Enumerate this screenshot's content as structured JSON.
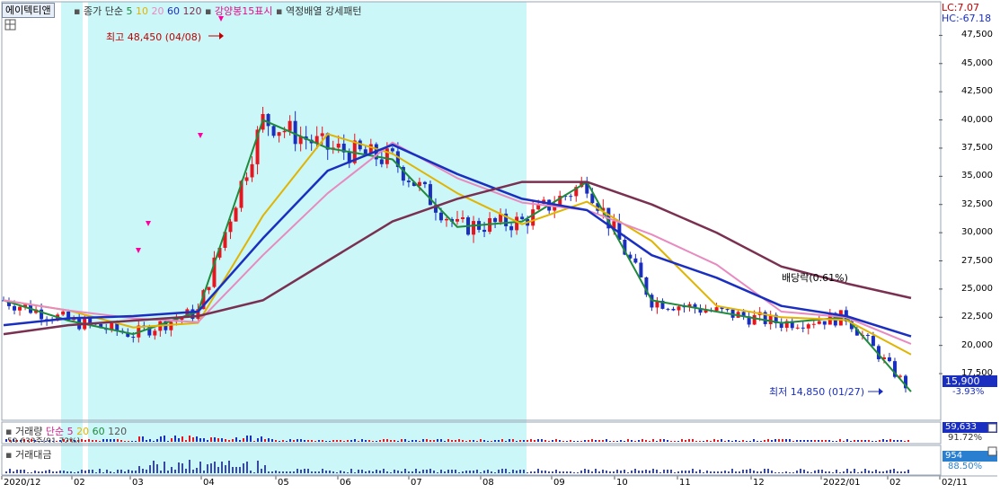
{
  "legend": {
    "stock_name": "에이텍티앤",
    "close_label": "종가 단순",
    "ma": [
      {
        "period": "5",
        "color": "#1f8a3c"
      },
      {
        "period": "10",
        "color": "#e0b400"
      },
      {
        "period": "20",
        "color": "#e88ac0"
      },
      {
        "period": "60",
        "color": "#1a2fc0"
      },
      {
        "period": "120",
        "color": "#7a3050"
      }
    ],
    "candle_label": "강양봉15표시",
    "pattern_label": "역정배열 강세패턴"
  },
  "corner": {
    "lc": "LC:7.07",
    "hc": "HC:-67.18"
  },
  "annotations": {
    "high": "최고 48,450 (04/08)",
    "low": "최저 14,850 (01/27)",
    "dividend": "배당락(0.61%)"
  },
  "price": {
    "current": "15,900",
    "change": "-3.93%"
  },
  "volume_panel": {
    "title": "거래량",
    "ma_label": "단순",
    "ma": [
      {
        "period": "5",
        "color": "#d01c8b"
      },
      {
        "period": "20",
        "color": "#e0b400"
      },
      {
        "period": "60",
        "color": "#1f8a3c"
      },
      {
        "period": "120",
        "color": "#555555"
      }
    ],
    "sub_value": "59,633주(91.72%)",
    "right_value": "59,633",
    "right_pct": "91.72%"
  },
  "amount_panel": {
    "title": "거래대금",
    "right_value": "954",
    "right_pct": "88.50%"
  },
  "chart_data": {
    "type": "candlestick",
    "y_ticks": [
      "47,500",
      "45,000",
      "42,500",
      "40,000",
      "37,500",
      "35,000",
      "32,500",
      "30,000",
      "27,500",
      "25,000",
      "22,500",
      "20,000",
      "17,500"
    ],
    "y_values": [
      47500,
      45000,
      42500,
      40000,
      37500,
      35000,
      32500,
      30000,
      27500,
      25000,
      22500,
      20000,
      17500
    ],
    "ylim": [
      14000,
      50000
    ],
    "x_ticks": [
      "2020/12",
      "02",
      "03",
      "04",
      "05",
      "06",
      "07",
      "08",
      "09",
      "10",
      "11",
      "12",
      "2022/01",
      "02",
      "02/11"
    ],
    "close_series": [
      [
        "2020/12",
        24000
      ],
      [
        "01",
        22200
      ],
      [
        "02",
        21000
      ],
      [
        "03",
        23000
      ],
      [
        "04",
        40000
      ],
      [
        "05",
        37500
      ],
      [
        "06",
        36500
      ],
      [
        "07",
        30500
      ],
      [
        "08",
        31000
      ],
      [
        "09",
        34500
      ],
      [
        "10",
        24000
      ],
      [
        "11",
        23000
      ],
      [
        "12",
        22000
      ],
      [
        "2022/01",
        22500
      ],
      [
        "02",
        15900
      ]
    ],
    "ma60_series": [
      21800,
      22400,
      22600,
      23000,
      29500,
      35500,
      37800,
      35200,
      33000,
      32000,
      28000,
      26000,
      23500,
      22600,
      20800
    ],
    "ma120_series": [
      21000,
      21800,
      22200,
      22600,
      24000,
      27500,
      31000,
      33000,
      34500,
      34500,
      32500,
      30000,
      27000,
      25500,
      24200
    ]
  }
}
